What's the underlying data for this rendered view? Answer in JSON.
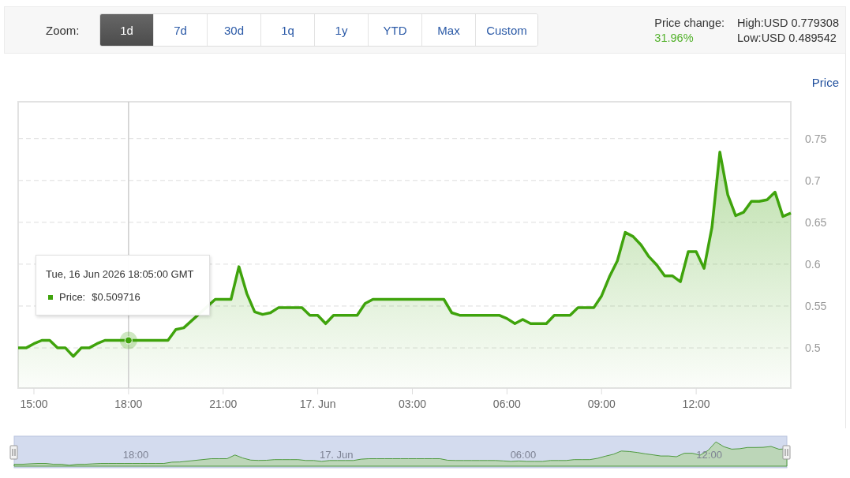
{
  "zoom_bar": {
    "label": "Zoom:",
    "buttons": [
      {
        "label": "1d",
        "selected": true
      },
      {
        "label": "7d",
        "selected": false
      },
      {
        "label": "30d",
        "selected": false
      },
      {
        "label": "1q",
        "selected": false
      },
      {
        "label": "1y",
        "selected": false
      },
      {
        "label": "YTD",
        "selected": false
      },
      {
        "label": "Max",
        "selected": false
      },
      {
        "label": "Custom",
        "selected": false
      }
    ]
  },
  "stats": {
    "change_label": "Price change:",
    "change_value": "31.96%",
    "high": "High:USD 0.779308",
    "low": "Low:USD 0.489542"
  },
  "chart": {
    "tooltip": {
      "date": "Tue, 16 Jun 2026 18:05:00 GMT",
      "series_label": "Price:",
      "value": "$0.509716"
    },
    "chart_data": {
      "type": "area",
      "ylabel": "Price",
      "grid": true,
      "ylim": [
        0.452,
        0.794
      ],
      "yticks": [
        {
          "value": 0.5,
          "label": "0.5"
        },
        {
          "value": 0.55,
          "label": "0.55"
        },
        {
          "value": 0.6,
          "label": "0.6"
        },
        {
          "value": 0.65,
          "label": "0.65"
        },
        {
          "value": 0.7,
          "label": "0.7"
        },
        {
          "value": 0.75,
          "label": "0.75"
        }
      ],
      "categories": [
        null,
        null,
        "15:00",
        null,
        null,
        null,
        null,
        null,
        null,
        null,
        null,
        null,
        null,
        null,
        "18:00",
        null,
        null,
        null,
        null,
        null,
        null,
        null,
        null,
        null,
        null,
        null,
        "21:00",
        null,
        null,
        null,
        null,
        null,
        null,
        null,
        null,
        null,
        null,
        null,
        "17. Jun",
        null,
        null,
        null,
        null,
        null,
        null,
        null,
        null,
        null,
        null,
        null,
        "03:00",
        null,
        null,
        null,
        null,
        null,
        null,
        null,
        null,
        null,
        null,
        null,
        "06:00",
        null,
        null,
        null,
        null,
        null,
        null,
        null,
        null,
        null,
        null,
        null,
        "09:00",
        null,
        null,
        null,
        null,
        null,
        null,
        null,
        null,
        null,
        null,
        null,
        "12:00",
        null,
        null,
        null,
        null,
        null,
        null,
        null,
        null,
        null,
        null,
        null,
        null
      ],
      "series": [
        {
          "color": "#3fa30c",
          "values": [
            0.5,
            0.5,
            0.505,
            0.509,
            0.509,
            0.5,
            0.5,
            0.49,
            0.5,
            0.5,
            0.505,
            0.509,
            0.509,
            0.509,
            0.509,
            0.509,
            0.509,
            0.509,
            0.509,
            0.509,
            0.522,
            0.524,
            null,
            null,
            null,
            0.558,
            0.558,
            0.558,
            0.597,
            0.565,
            0.543,
            0.54,
            0.542,
            0.548,
            0.548,
            0.548,
            0.548,
            0.539,
            0.539,
            0.529,
            0.539,
            0.539,
            0.539,
            0.539,
            0.553,
            0.558,
            0.558,
            0.558,
            0.558,
            0.558,
            0.558,
            0.558,
            0.558,
            0.558,
            0.558,
            0.542,
            0.539,
            0.539,
            0.539,
            0.539,
            0.539,
            0.539,
            0.535,
            0.529,
            0.534,
            0.529,
            0.529,
            0.529,
            0.539,
            0.539,
            0.539,
            0.548,
            0.548,
            0.548,
            0.562,
            0.585,
            0.604,
            0.638,
            0.633,
            0.623,
            0.609,
            0.599,
            0.586,
            0.586,
            0.579,
            0.615,
            0.615,
            0.595,
            0.644,
            0.734,
            0.683,
            0.658,
            0.662,
            0.675,
            0.675,
            0.677,
            0.686,
            0.657,
            0.661
          ]
        }
      ],
      "annotations": [
        {
          "x": "18:00"
        }
      ]
    }
  },
  "navigator": {
    "labels": [
      "18:00",
      "17. Jun",
      "06:00",
      "12:00"
    ]
  }
}
